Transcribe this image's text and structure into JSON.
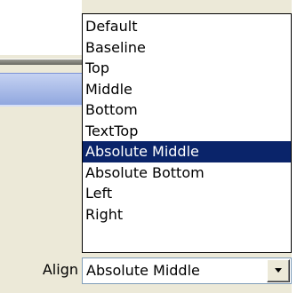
{
  "align": {
    "label": "Align",
    "selected_value": "Absolute Middle",
    "button_icon": "chevron-down-icon",
    "options": [
      "Default",
      "Baseline",
      "Top",
      "Middle",
      "Bottom",
      "TextTop",
      "Absolute Middle",
      "Absolute Bottom",
      "Left",
      "Right"
    ],
    "highlighted_option": "Absolute Middle"
  },
  "colors": {
    "highlight_bg": "#0a246a",
    "highlight_fg": "#ffffff",
    "window_bg": "#ece9d8"
  }
}
